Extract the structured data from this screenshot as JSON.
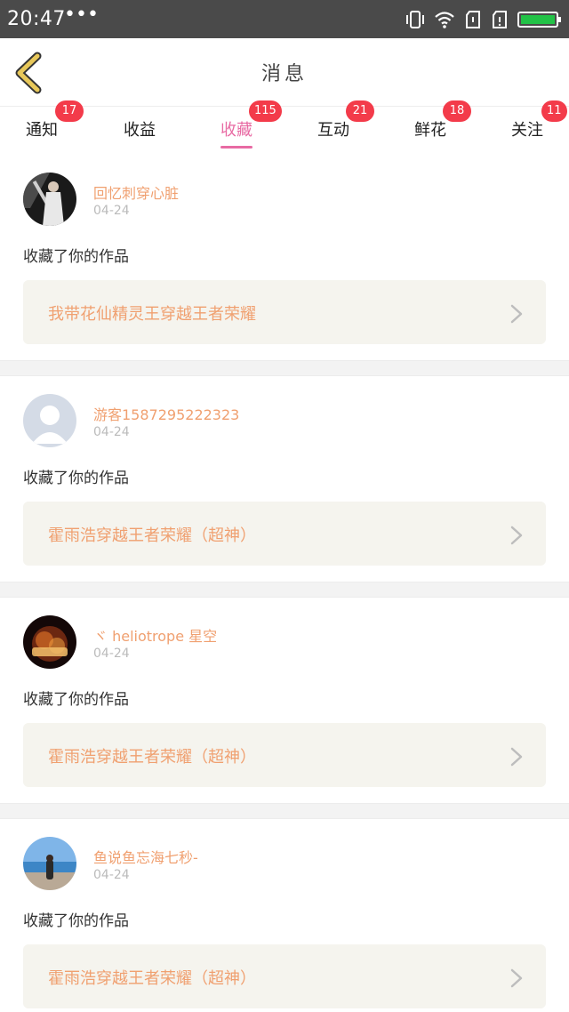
{
  "status_bar": {
    "time": "20:47",
    "dots": "•••",
    "icons": [
      "vibrate-icon",
      "wifi-icon",
      "sim1-icon",
      "sim2-icon",
      "battery-icon"
    ],
    "battery_color": "#22c247"
  },
  "nav": {
    "title": "消息",
    "back_icon": "chevron-left-icon",
    "back_color": "#e8c85a"
  },
  "tabs": [
    {
      "label": "通知",
      "badge": "17",
      "active": false
    },
    {
      "label": "收益",
      "badge": "",
      "active": false
    },
    {
      "label": "收藏",
      "badge": "115",
      "active": true
    },
    {
      "label": "互动",
      "badge": "21",
      "active": false
    },
    {
      "label": "鲜花",
      "badge": "18",
      "active": false
    },
    {
      "label": "关注",
      "badge": "11",
      "active": false
    }
  ],
  "colors": {
    "accent": "#e86aa3",
    "badge": "#f33b4a",
    "name": "#f0a070",
    "work_bg": "#f5f4ee"
  },
  "messages": [
    {
      "user": "回忆刺穿心脏",
      "date": "04-24",
      "action": "收藏了你的作品",
      "work": "我带花仙精灵王穿越王者荣耀",
      "avatar": "photo-avatar"
    },
    {
      "user": "游客1587295222323",
      "date": "04-24",
      "action": "收藏了你的作品",
      "work": "霍雨浩穿越王者荣耀（超神）",
      "avatar": "default-avatar"
    },
    {
      "user": "ヾ heliotrope 星空",
      "date": "04-24",
      "action": "收藏了你的作品",
      "work": "霍雨浩穿越王者荣耀（超神）",
      "avatar": "fire-love-avatar"
    },
    {
      "user": "鱼说鱼忘海七秒-",
      "date": "04-24",
      "action": "收藏了你的作品",
      "work": "霍雨浩穿越王者荣耀（超神）",
      "avatar": "beach-avatar"
    }
  ]
}
